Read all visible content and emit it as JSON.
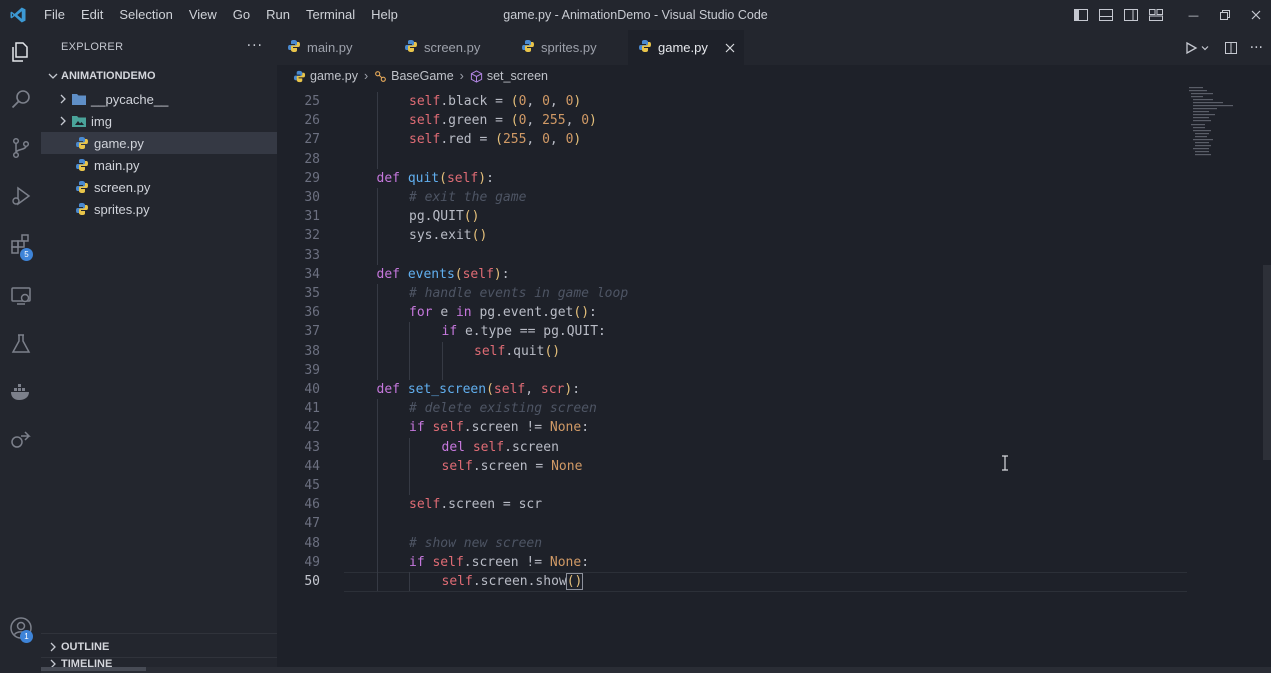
{
  "window": {
    "title": "game.py - AnimationDemo - Visual Studio Code",
    "menu": [
      "File",
      "Edit",
      "Selection",
      "View",
      "Go",
      "Run",
      "Terminal",
      "Help"
    ]
  },
  "activity": {
    "extensions_badge": "5",
    "accounts_badge": "1"
  },
  "sidebar": {
    "header": "EXPLORER",
    "more": "···",
    "project": "ANIMATIONDEMO",
    "items": [
      {
        "label": "__pycache__",
        "type": "folder"
      },
      {
        "label": "img",
        "type": "folder"
      },
      {
        "label": "game.py",
        "type": "file"
      },
      {
        "label": "main.py",
        "type": "file"
      },
      {
        "label": "screen.py",
        "type": "file"
      },
      {
        "label": "sprites.py",
        "type": "file"
      }
    ],
    "outline": "OUTLINE",
    "timeline": "TIMELINE"
  },
  "tabs": [
    {
      "label": "main.py"
    },
    {
      "label": "screen.py"
    },
    {
      "label": "sprites.py"
    },
    {
      "label": "game.py",
      "active": true
    }
  ],
  "breadcrumb": {
    "file": "game.py",
    "class": "BaseGame",
    "method": "set_screen"
  },
  "editor": {
    "current_line": "50",
    "lines": [
      {
        "n": "25",
        "indent": 2,
        "tokens": [
          [
            "slf",
            "self"
          ],
          [
            "p",
            ".black = "
          ],
          [
            "br",
            "("
          ],
          [
            "num",
            "0"
          ],
          [
            "p",
            ", "
          ],
          [
            "num",
            "0"
          ],
          [
            "p",
            ", "
          ],
          [
            "num",
            "0"
          ],
          [
            "br",
            ")"
          ]
        ]
      },
      {
        "n": "26",
        "indent": 2,
        "tokens": [
          [
            "slf",
            "self"
          ],
          [
            "p",
            ".green = "
          ],
          [
            "br",
            "("
          ],
          [
            "num",
            "0"
          ],
          [
            "p",
            ", "
          ],
          [
            "num",
            "255"
          ],
          [
            "p",
            ", "
          ],
          [
            "num",
            "0"
          ],
          [
            "br",
            ")"
          ]
        ]
      },
      {
        "n": "27",
        "indent": 2,
        "tokens": [
          [
            "slf",
            "self"
          ],
          [
            "p",
            ".red = "
          ],
          [
            "br",
            "("
          ],
          [
            "num",
            "255"
          ],
          [
            "p",
            ", "
          ],
          [
            "num",
            "0"
          ],
          [
            "p",
            ", "
          ],
          [
            "num",
            "0"
          ],
          [
            "br",
            ")"
          ]
        ]
      },
      {
        "n": "28",
        "indent": 0,
        "tokens": []
      },
      {
        "n": "29",
        "indent": 1,
        "tokens": [
          [
            "kw",
            "def "
          ],
          [
            "fn",
            "quit"
          ],
          [
            "br",
            "("
          ],
          [
            "slf",
            "self"
          ],
          [
            "br",
            ")"
          ],
          [
            "p",
            ":"
          ]
        ]
      },
      {
        "n": "30",
        "indent": 2,
        "tokens": [
          [
            "cm",
            "# exit the game"
          ]
        ]
      },
      {
        "n": "31",
        "indent": 2,
        "tokens": [
          [
            "p",
            "pg.QUIT"
          ],
          [
            "br",
            "()"
          ]
        ]
      },
      {
        "n": "32",
        "indent": 2,
        "tokens": [
          [
            "p",
            "sys.exit"
          ],
          [
            "br",
            "()"
          ]
        ]
      },
      {
        "n": "33",
        "indent": 0,
        "tokens": []
      },
      {
        "n": "34",
        "indent": 1,
        "tokens": [
          [
            "kw",
            "def "
          ],
          [
            "fn",
            "events"
          ],
          [
            "br",
            "("
          ],
          [
            "slf",
            "self"
          ],
          [
            "br",
            ")"
          ],
          [
            "p",
            ":"
          ]
        ]
      },
      {
        "n": "35",
        "indent": 2,
        "tokens": [
          [
            "cm",
            "# handle events in game loop"
          ]
        ]
      },
      {
        "n": "36",
        "indent": 2,
        "tokens": [
          [
            "kw",
            "for "
          ],
          [
            "p",
            "e "
          ],
          [
            "kw",
            "in "
          ],
          [
            "p",
            "pg.event.get"
          ],
          [
            "br",
            "()"
          ],
          [
            "p",
            ":"
          ]
        ]
      },
      {
        "n": "37",
        "indent": 3,
        "tokens": [
          [
            "kw",
            "if "
          ],
          [
            "p",
            "e.type == pg.QUIT:"
          ]
        ]
      },
      {
        "n": "38",
        "indent": 4,
        "tokens": [
          [
            "slf",
            "self"
          ],
          [
            "p",
            ".quit"
          ],
          [
            "br",
            "()"
          ]
        ]
      },
      {
        "n": "39",
        "indent": 0,
        "tokens": []
      },
      {
        "n": "40",
        "indent": 1,
        "tokens": [
          [
            "kw",
            "def "
          ],
          [
            "fn",
            "set_screen"
          ],
          [
            "br",
            "("
          ],
          [
            "slf",
            "self"
          ],
          [
            "p",
            ", "
          ],
          [
            "slf",
            "scr"
          ],
          [
            "br",
            ")"
          ],
          [
            "p",
            ":"
          ]
        ]
      },
      {
        "n": "41",
        "indent": 2,
        "tokens": [
          [
            "cm",
            "# delete existing screen"
          ]
        ]
      },
      {
        "n": "42",
        "indent": 2,
        "tokens": [
          [
            "kw",
            "if "
          ],
          [
            "slf",
            "self"
          ],
          [
            "p",
            ".screen != "
          ],
          [
            "num",
            "None"
          ],
          [
            "p",
            ":"
          ]
        ]
      },
      {
        "n": "43",
        "indent": 3,
        "tokens": [
          [
            "kw",
            "del "
          ],
          [
            "slf",
            "self"
          ],
          [
            "p",
            ".screen"
          ]
        ]
      },
      {
        "n": "44",
        "indent": 3,
        "tokens": [
          [
            "slf",
            "self"
          ],
          [
            "p",
            ".screen = "
          ],
          [
            "num",
            "None"
          ]
        ]
      },
      {
        "n": "45",
        "indent": 0,
        "tokens": []
      },
      {
        "n": "46",
        "indent": 2,
        "tokens": [
          [
            "slf",
            "self"
          ],
          [
            "p",
            ".screen = scr"
          ]
        ]
      },
      {
        "n": "47",
        "indent": 0,
        "tokens": []
      },
      {
        "n": "48",
        "indent": 2,
        "tokens": [
          [
            "cm",
            "# show new screen"
          ]
        ]
      },
      {
        "n": "49",
        "indent": 2,
        "tokens": [
          [
            "kw",
            "if "
          ],
          [
            "slf",
            "self"
          ],
          [
            "p",
            ".screen != "
          ],
          [
            "num",
            "None"
          ],
          [
            "p",
            ":"
          ]
        ]
      },
      {
        "n": "50",
        "indent": 3,
        "tokens": [
          [
            "slf",
            "self"
          ],
          [
            "p",
            ".screen.show"
          ],
          [
            "brbox",
            "()"
          ]
        ]
      }
    ]
  },
  "colors": {
    "keyword": "#c678dd",
    "self": "#e06c75",
    "function": "#61afef",
    "number": "#d19a66",
    "comment": "#4e5564",
    "bracket": "#e5c07b",
    "accent": "#3e84d8"
  }
}
